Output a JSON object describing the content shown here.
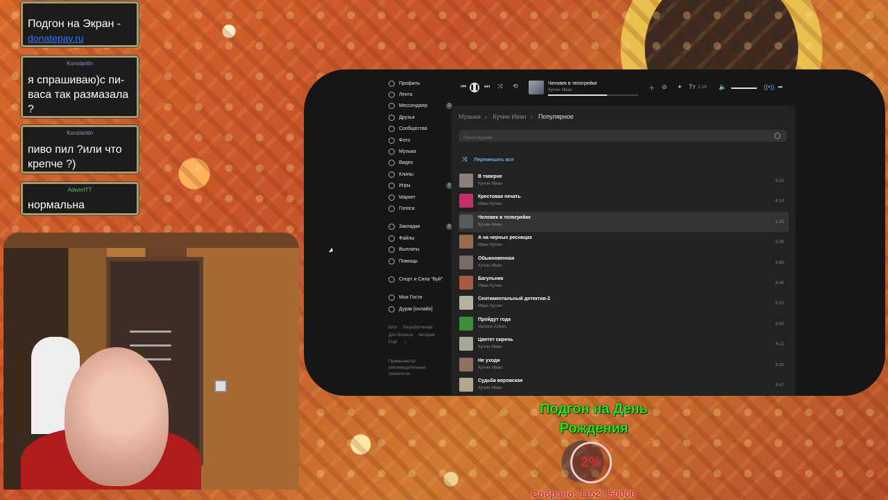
{
  "chat": [
    {
      "user": "",
      "text": "Подгон на Экран -",
      "link": "donatepay.ru"
    },
    {
      "user": "Konstantin",
      "text": "я спрашиваю)с пи-васа так размазала ?"
    },
    {
      "user": "Konstantin",
      "text": "пиво пил ?или что крепче ?)"
    },
    {
      "user": "AdwertTT",
      "text": "нормальна"
    }
  ],
  "sidebar": {
    "items": [
      {
        "label": "Профиль"
      },
      {
        "label": "Лента"
      },
      {
        "label": "Мессенджер",
        "badge": "2"
      },
      {
        "label": "Друзья"
      },
      {
        "label": "Сообщества"
      },
      {
        "label": "Фото"
      },
      {
        "label": "Музыка"
      },
      {
        "label": "Видео"
      },
      {
        "label": "Клипы"
      },
      {
        "label": "Игры",
        "badge": "2"
      },
      {
        "label": "Маркет"
      },
      {
        "label": "Голоса"
      }
    ],
    "items2": [
      {
        "label": "Закладки",
        "badge": "3"
      },
      {
        "label": "Файлы"
      },
      {
        "label": "Выплаты"
      },
      {
        "label": "Помощь"
      }
    ],
    "group": "Спорт и Сила \"Буй\"",
    "apps": [
      {
        "label": "Мои Гости"
      },
      {
        "label": "Дурак [онлайн]"
      }
    ],
    "footer": [
      "Блог",
      "Разработчикам",
      "Для бизнеса",
      "Авторам",
      "Ещё"
    ],
    "note": "Применяются рекомендательные технологии"
  },
  "player": {
    "title": "Человек в телогрейке",
    "artist": "Кучин Иван",
    "time": "1:29",
    "progress": 0.65,
    "volume": 0.75
  },
  "crumbs": [
    "Музыка",
    "Кучин Иван",
    "Популярное"
  ],
  "search": {
    "placeholder": "Поиск музыки"
  },
  "shuffle_label": "Перемешать все",
  "tracks": [
    {
      "name": "В таверне",
      "artist": "Кучин Иван",
      "dur": "4:22",
      "color": "#8a8079"
    },
    {
      "name": "Крестовая печать",
      "artist": "Иван Кучин",
      "dur": "4:14",
      "color": "#c0306a"
    },
    {
      "name": "Человек в телогрейке",
      "artist": "Кучин Иван",
      "dur": "1:29",
      "color": "#555a60",
      "active": true
    },
    {
      "name": "А на черных ресницах",
      "artist": "Иван Кучин",
      "dur": "3:26",
      "color": "#9a6b4e"
    },
    {
      "name": "Обыкновенная",
      "artist": "Кучин Иван",
      "dur": "3:40",
      "color": "#7a6a66"
    },
    {
      "name": "Багульник",
      "artist": "Иван Кучин",
      "dur": "3:46",
      "color": "#a55a44"
    },
    {
      "name": "Сентиментальный детектив-2",
      "artist": "Иван Кучин",
      "dur": "3:31",
      "color": "#b8b0a0"
    },
    {
      "name": "Пройдут года",
      "artist": "Various Artists",
      "dur": "3:42",
      "color": "#3a8f3a"
    },
    {
      "name": "Цветет сирень",
      "artist": "Кучин Иван",
      "dur": "4:11",
      "color": "#a8a89a"
    },
    {
      "name": "Не уходи",
      "artist": "Кучин Иван",
      "dur": "3:33",
      "color": "#8e7060"
    },
    {
      "name": "Судьба воровская",
      "artist": "Кучин Иван",
      "dur": "3:47",
      "color": "#b0a890"
    }
  ],
  "goal": {
    "title": "Подгон на День Рождения",
    "percent": "2%",
    "collected": "Собрано: 1152 / 50000"
  }
}
